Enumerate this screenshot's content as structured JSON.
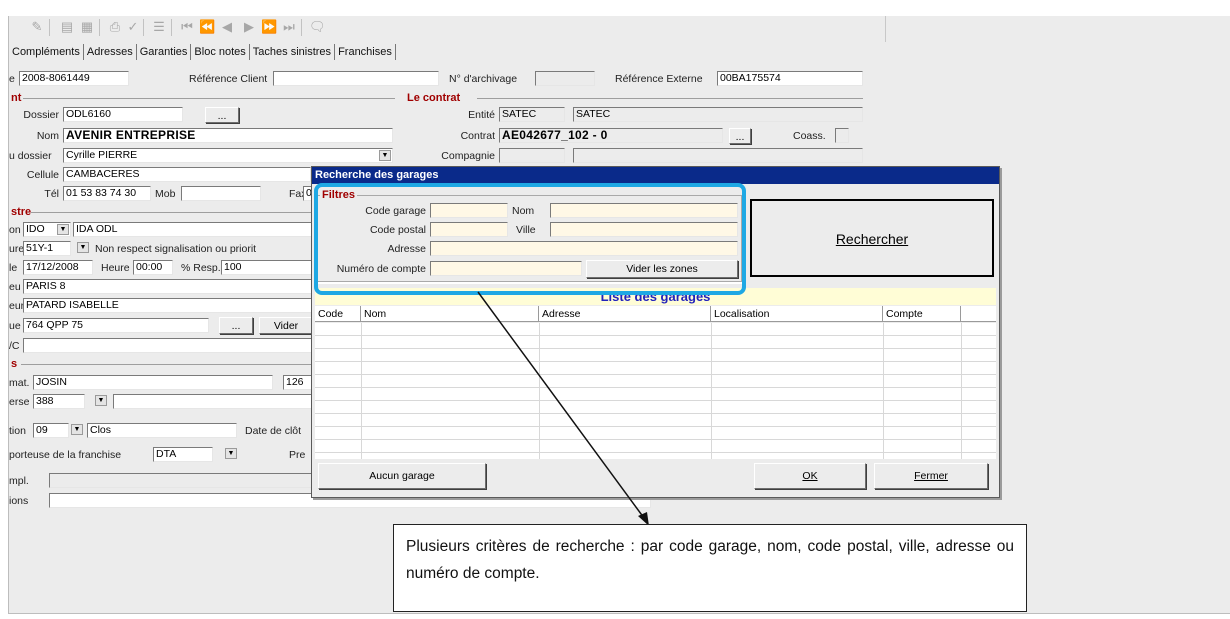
{
  "toolbar": {
    "icons": [
      "edit-icon",
      "view-icon",
      "image-icon",
      "print-icon",
      "check-icon",
      "list-icon",
      "first-icon",
      "prev-page-icon",
      "prev-icon",
      "next-icon",
      "next-page-icon",
      "last-icon",
      "comment-icon"
    ]
  },
  "tabs": [
    "Compléments",
    "Adresses",
    "Garanties",
    "Bloc notes",
    "Taches sinistres",
    "Franchises"
  ],
  "top_row": {
    "prefix_label": "e",
    "ref_value": "2008-8061449",
    "ref_client_label": "Référence Client",
    "ref_client_value": "",
    "archivage_label": "N° d'archivage",
    "archivage_value": "",
    "ref_externe_label": "Référence Externe",
    "ref_externe_value": "00BA175574"
  },
  "client_section": {
    "title": "nt",
    "dossier_label": "Dossier",
    "dossier_value": "ODL6160",
    "dossier_button": "...",
    "nom_label": "Nom",
    "nom_value": "AVENIR ENTREPRISE",
    "gest_label": "u dossier",
    "gest_value": "Cyrille PIERRE",
    "cellule_label": "Cellule",
    "cellule_value": "CAMBACERES",
    "tel_label": "Tél",
    "tel_value": "01 53 83 74 30",
    "mob_label": "Mob",
    "mob_value": "",
    "fax_label": "Fax",
    "fax_value": "0"
  },
  "contrat_section": {
    "title": "Le contrat",
    "entite_label": "Entité",
    "entite_code": "SATEC",
    "entite_name": "SATEC",
    "contrat_label": "Contrat",
    "contrat_value": "AE042677_102 - 0",
    "contrat_button": "...",
    "coass_label": "Coass.",
    "coass_value": "",
    "compagnie_label": "Compagnie",
    "compagnie_code": "",
    "compagnie_name": ""
  },
  "sinistre_section": {
    "title": "stre",
    "code_label": "on",
    "code_value": "IDO",
    "code_desc": "IDA ODL",
    "nature_label": "ure",
    "nature_value": "51Y-1",
    "nature_desc": "Non respect signalisation ou priorit",
    "date_label": "le",
    "date_value": "17/12/2008",
    "heure_label": "Heure",
    "heure_value": "00:00",
    "resp_label": "% Resp.",
    "resp_value": "100",
    "lieu_label": "eu",
    "lieu_value": "PARIS 8",
    "redacteur_label": "eur",
    "redacteur_value": "PATARD ISABELLE",
    "ref_label": "ue",
    "ref_value": "764 QPP 75",
    "ref_button": "...",
    "vider_button": "Vider",
    "vc_label": "/C",
    "vc_value": ""
  },
  "tiers_section": {
    "title": "s",
    "immat_label": "mat.",
    "immat_value": "JOSIN",
    "immat_extra": "126",
    "adverse_label": "erse",
    "adverse_value": "388",
    "situation_label": "tion",
    "situation_value": "09",
    "situation_desc": "Clos",
    "cloture_label": "Date de clôt",
    "franchise_label": "porteuse de la franchise",
    "franchise_value": "DTA",
    "pre_label": "Pre",
    "compl_label": "mpl.",
    "compl_value": "",
    "obs_label": "ions",
    "obs_value": ""
  },
  "dialog": {
    "title": "Recherche des garages",
    "filters_title": "Filtres",
    "code_garage_label": "Code garage",
    "code_garage_value": "",
    "nom_label": "Nom",
    "nom_value": "",
    "code_postal_label": "Code postal",
    "code_postal_value": "",
    "ville_label": "Ville",
    "ville_value": "",
    "adresse_label": "Adresse",
    "adresse_value": "",
    "compte_label": "Numéro de compte",
    "compte_value": "",
    "vider_button": "Vider les zones",
    "rechercher_button": "Rechercher",
    "list_title": "Liste des garages",
    "columns": [
      "Code",
      "Nom",
      "Adresse",
      "Localisation",
      "Compte"
    ],
    "aucun_button": "Aucun garage",
    "ok_button": "OK",
    "fermer_button": "Fermer"
  },
  "callout": {
    "text": "Plusieurs critères de recherche : par code garage, nom, code postal, ville, adresse ou numéro de compte."
  },
  "colors": {
    "highlight": "#1ea8e4",
    "title_bar": "#0a2a8a",
    "section_title": "#a00000",
    "list_title": "#2222bb"
  }
}
